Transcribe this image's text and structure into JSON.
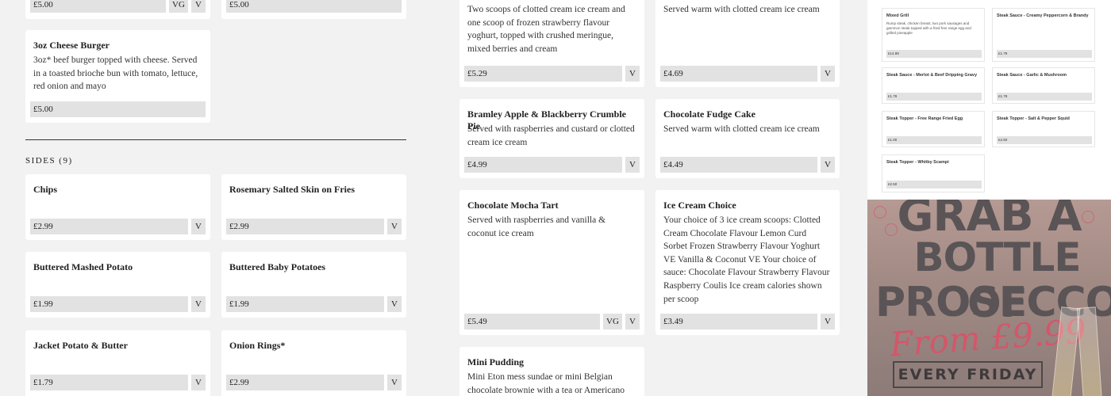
{
  "col1": {
    "top_cards": [
      {
        "price": "£5.00",
        "tags": [
          "VG",
          "V"
        ]
      },
      {
        "price": "£5.00",
        "tags": []
      }
    ],
    "burger": {
      "name": "3oz Cheese Burger",
      "desc": "3oz* beef burger topped with cheese. Served in a toasted brioche bun with tomato, lettuce, red onion and mayo",
      "price": "£5.00"
    },
    "sides_heading": "SIDES (9)",
    "sides": [
      {
        "name": "Chips",
        "price": "£2.99",
        "tag": "V"
      },
      {
        "name": "Rosemary Salted Skin on Fries",
        "price": "£2.99",
        "tag": "V"
      },
      {
        "name": "Buttered Mashed Potato",
        "price": "£1.99",
        "tag": "V"
      },
      {
        "name": "Buttered Baby Potatoes",
        "price": "£1.99",
        "tag": "V"
      },
      {
        "name": "Jacket Potato & Butter",
        "price": "£1.79",
        "tag": "V"
      },
      {
        "name": "Onion Rings*",
        "price": "£2.99",
        "tag": "V"
      }
    ]
  },
  "col2": {
    "desserts": [
      {
        "name": "",
        "desc": "Two scoops of clotted cream ice cream and one scoop of frozen strawberry flavour yoghurt, topped with crushed meringue, mixed berries and cream",
        "price": "£5.29",
        "tags": [
          "V"
        ]
      },
      {
        "name": "",
        "desc": "Served warm with clotted cream ice cream",
        "price": "£4.69",
        "tags": [
          "V"
        ]
      },
      {
        "name": "Bramley Apple & Blackberry Crumble Pie",
        "desc": "Served with raspberries and custard or clotted cream ice cream",
        "price": "£4.99",
        "tags": [
          "V"
        ]
      },
      {
        "name": "Chocolate Fudge Cake",
        "desc": "Served warm with clotted cream ice cream",
        "price": "£4.49",
        "tags": [
          "V"
        ]
      },
      {
        "name": "Chocolate Mocha Tart",
        "desc": "Served with raspberries and vanilla & coconut ice cream",
        "price": "£5.49",
        "tags": [
          "VG",
          "V"
        ]
      },
      {
        "name": "Ice Cream Choice",
        "desc": "Your choice of 3 ice cream scoops: Clotted Cream Chocolate Flavour Lemon Curd Sorbet Frozen Strawberry Flavour Yoghurt VE Vanilla & Coconut VE Your choice of sauce: Chocolate Flavour Strawberry Flavour Raspberry Coulis Ice cream calories shown per scoop",
        "price": "£3.49",
        "tags": [
          "V"
        ]
      },
      {
        "name": "Mini Pudding",
        "desc": "Mini Eton mess sundae or mini Belgian chocolate brownie with a tea or Americano",
        "price": "",
        "tags": []
      }
    ]
  },
  "col3": {
    "mini_cards": [
      {
        "name": "Mixed Grill",
        "desc": "Rump steak, chicken breast, two pork sausages and gammon steak topped with a fried free range egg and grilled pineapple",
        "price": "£14.99"
      },
      {
        "name": "Steak Sauce - Creamy Peppercorn & Brandy",
        "desc": "",
        "price": "£1.79"
      },
      {
        "name": "Steak Sauce - Merlot & Beef Dripping Gravy",
        "desc": "",
        "price": "£1.79"
      },
      {
        "name": "Steak Sauce - Garlic & Mushroom",
        "desc": "",
        "price": "£1.79"
      },
      {
        "name": "Steak Topper - Free Range Fried Egg",
        "desc": "",
        "price": "£1.00"
      },
      {
        "name": "Steak Topper - Salt & Pepper Squid",
        "desc": "",
        "price": "£2.50"
      },
      {
        "name": "Steak Topper - Whitby Scampi",
        "desc": "",
        "price": "£2.50"
      }
    ],
    "poster": {
      "line1": "GRAB A",
      "line2": "BOTTLE OF",
      "line3": "PROSECCO",
      "from": "From £9.99",
      "friday": "EVERY FRIDAY"
    }
  }
}
